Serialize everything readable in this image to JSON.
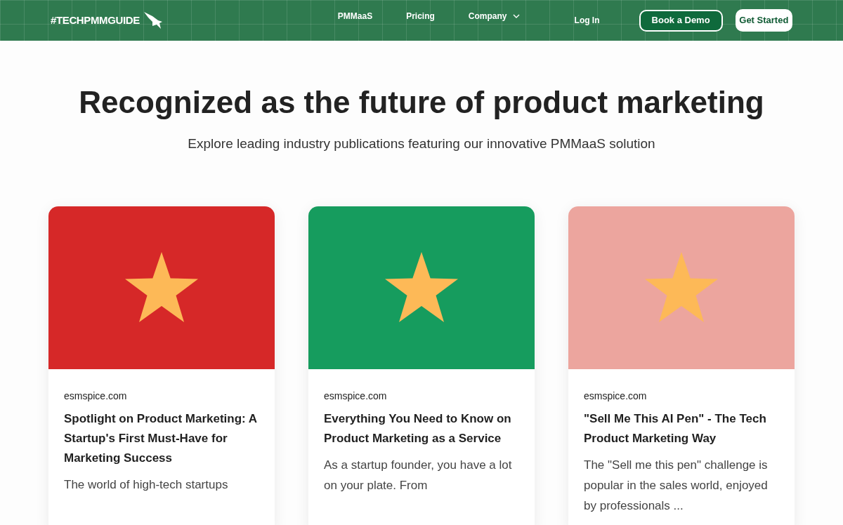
{
  "header": {
    "logo": "#TECHPMMGUIDE",
    "nav": [
      {
        "label": "PMMaaS",
        "dropdown": false
      },
      {
        "label": "Pricing",
        "dropdown": false
      },
      {
        "label": "Company",
        "dropdown": true
      }
    ],
    "login": "Log In",
    "demo_button": "Book a Demo",
    "start_button": "Get Started"
  },
  "hero": {
    "title": "Recognized as the future of product marketing",
    "subtitle": "Explore leading industry publications featuring our innovative PMMaaS solution"
  },
  "cards": [
    {
      "color": "#d62828",
      "source": "esmspice.com",
      "title": "Spotlight on Product Marketing: A Startup's First Must-Have for Marketing Success",
      "excerpt": "The world of high-tech startups"
    },
    {
      "color": "#169c5e",
      "source": "esmspice.com",
      "title": "Everything You Need to Know on Product Marketing as a Service",
      "excerpt": "As a startup founder, you have a lot on your plate. From"
    },
    {
      "color": "#eca59e",
      "source": "esmspice.com",
      "title": "\"Sell Me This AI Pen\" - The Tech Product Marketing Way",
      "excerpt": "The \"Sell me this pen\" challenge is popular in the sales world, enjoyed by professionals ..."
    }
  ]
}
